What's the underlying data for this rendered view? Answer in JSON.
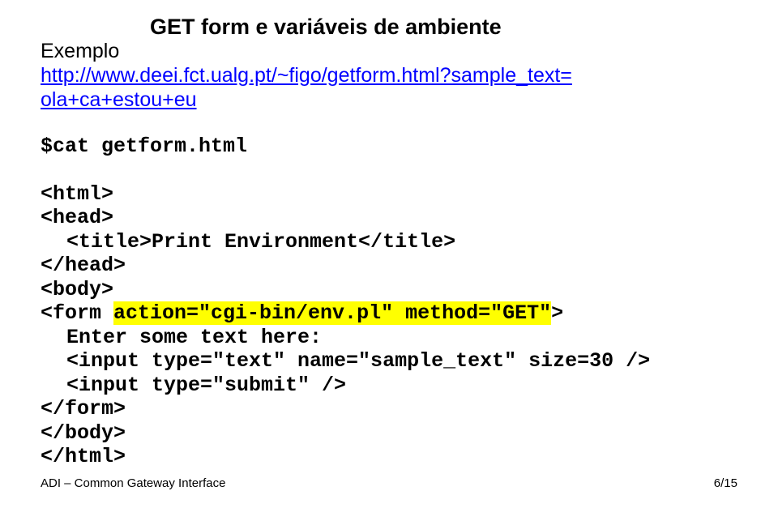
{
  "header": {
    "title": "GET form e variáveis de ambiente",
    "example_label": "Exemplo"
  },
  "url": {
    "line1": "http://www.deei.fct.ualg.pt/~figo/getform.html?sample_text=",
    "line2": "ola+ca+estou+eu"
  },
  "cmd": "$cat getform.html",
  "code": {
    "l1": "<html>",
    "l2": "<head>",
    "l3": "<title>Print Environment</title>",
    "l4": "</head>",
    "l5": "<body>",
    "l6a": "<form ",
    "l6b": "action=\"cgi-bin/env.pl\" method=\"GET\"",
    "l6c": ">",
    "l7": "Enter some text here:",
    "l8": "<input type=\"text\" name=\"sample_text\" size=30 />",
    "l9": "<input type=\"submit\" />",
    "l10": "</form>",
    "l11": "</body>",
    "l12": "</html>"
  },
  "footer": {
    "left": "ADI – Common Gateway Interface",
    "right": "6/15"
  }
}
